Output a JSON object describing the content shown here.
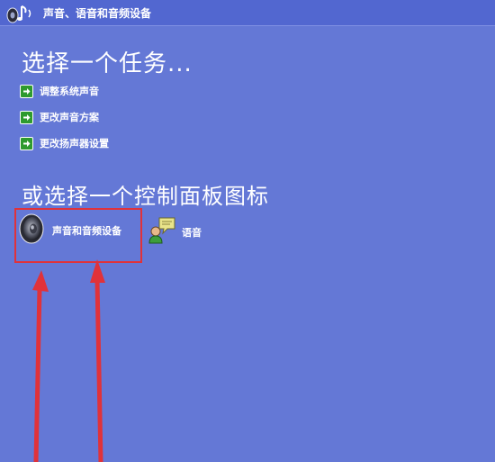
{
  "header": {
    "title": "声音、语音和音频设备",
    "icon": "sound-speech-audio-icon"
  },
  "tasks": {
    "heading": "选择一个任务...",
    "items": [
      {
        "label": "调整系统声音",
        "icon": "green-arrow-icon"
      },
      {
        "label": "更改声音方案",
        "icon": "green-arrow-icon"
      },
      {
        "label": "更改扬声器设置",
        "icon": "green-arrow-icon"
      }
    ]
  },
  "control_panel": {
    "heading": "或选择一个控制面板图标",
    "items": [
      {
        "label": "声音和音频设备",
        "icon": "speaker-icon"
      },
      {
        "label": "语音",
        "icon": "speech-icon"
      }
    ]
  },
  "annotation": {
    "color": "#e0323a"
  },
  "colors": {
    "background": "#6478d6",
    "header": "#5267d0",
    "task_arrow": "#2e9a2e"
  }
}
